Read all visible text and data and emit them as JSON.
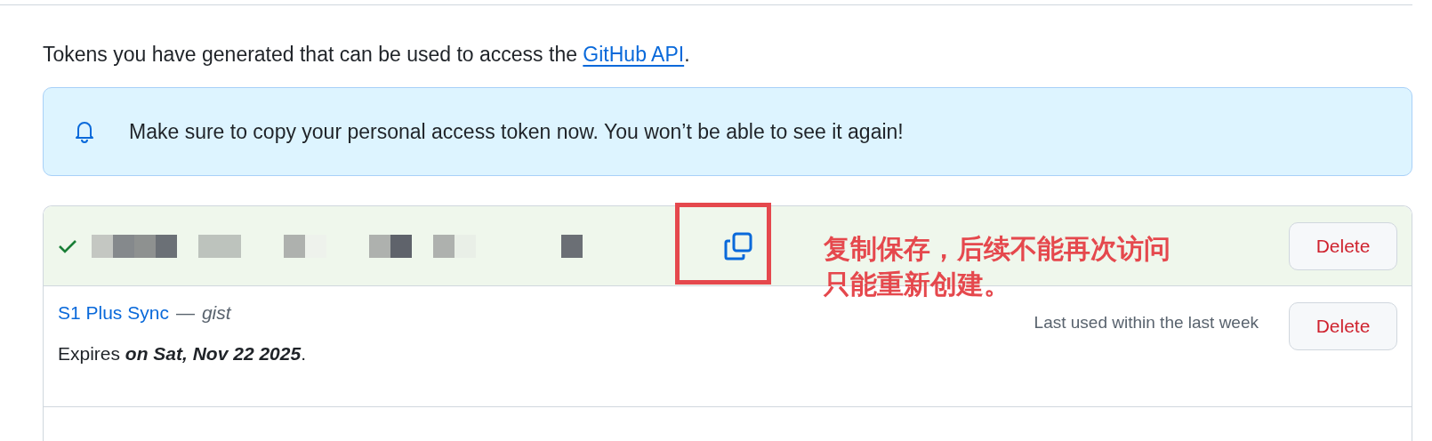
{
  "intro": {
    "text": "Tokens you have generated that can be used to access the ",
    "link": "GitHub API",
    "end": "."
  },
  "alert": {
    "text": "Make sure to copy your personal access token now. You won’t be able to see it again!"
  },
  "new_token": {
    "delete": "Delete"
  },
  "annotation": {
    "lines": [
      "复制保存，后续不能再次访问",
      "只能重新创建。"
    ]
  },
  "tokens": [
    {
      "name": "S1 Plus Sync",
      "separator": "—",
      "scope": "gist",
      "last_used": "Last used within the last week",
      "expires_prefix": "Expires ",
      "expires": "on Sat, Nov 22 2025",
      "expires_end": ".",
      "delete": "Delete"
    }
  ]
}
